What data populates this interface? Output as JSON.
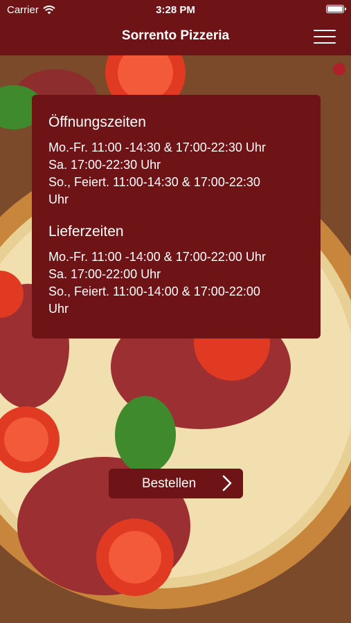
{
  "status_bar": {
    "carrier": "Carrier",
    "time": "3:28 PM",
    "battery_level": 1.0
  },
  "nav": {
    "title": "Sorrento Pizzeria",
    "menu_icon": "hamburger-menu-icon"
  },
  "background": {
    "description_icon": "pizza-background-image"
  },
  "opening_hours": {
    "title": "Öffnungszeiten",
    "lines": [
      "Mo.-Fr. 11:00 -14:30 & 17:00-22:30 Uhr",
      "Sa. 17:00-22:30 Uhr",
      "So., Feiert. 11:00-14:30 & 17:00-22:30",
      "Uhr"
    ]
  },
  "delivery_hours": {
    "title": "Lieferzeiten",
    "lines": [
      "Mo.-Fr. 11:00 -14:00 & 17:00-22:00 Uhr",
      "Sa. 17:00-22:00 Uhr",
      "So., Feiert. 11:00-14:00 & 17:00-22:00",
      "Uhr"
    ]
  },
  "order_button": {
    "label": "Bestellen",
    "icon": "chevron-right-icon"
  },
  "colors": {
    "brand": "#6e1416",
    "text": "#ffffff"
  }
}
